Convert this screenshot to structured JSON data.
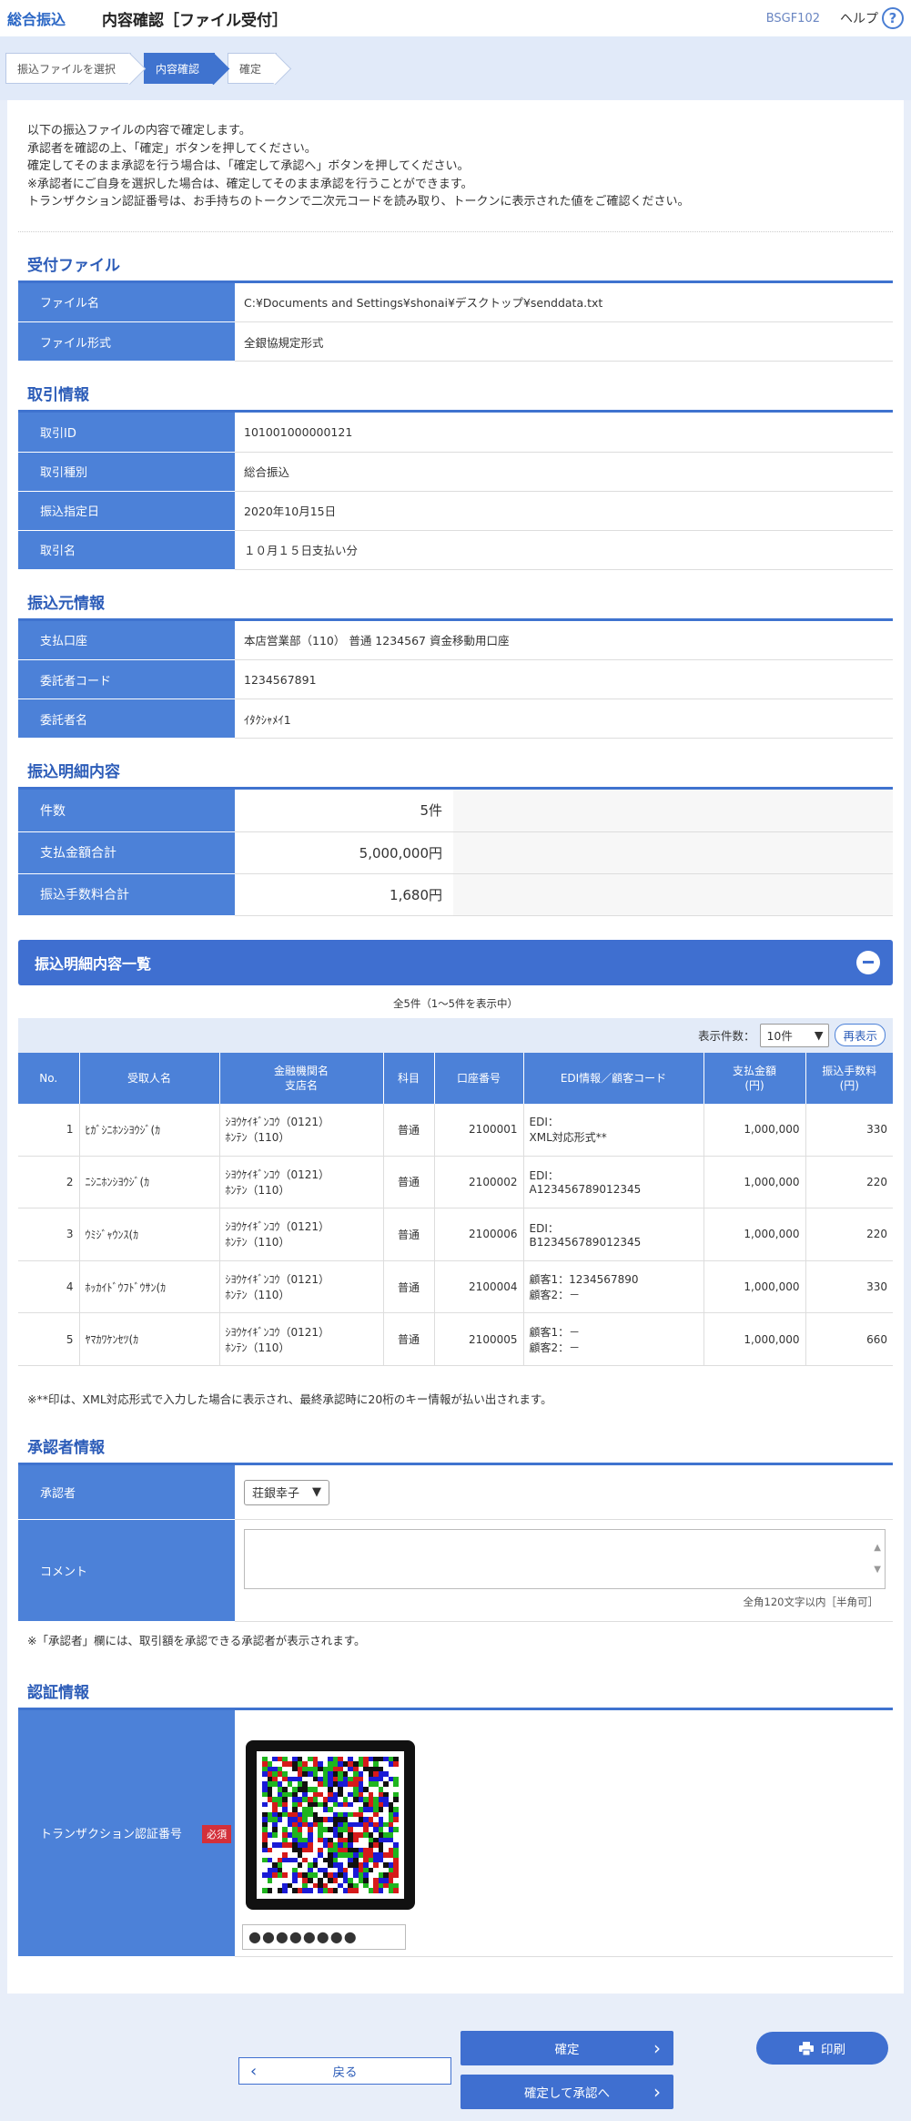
{
  "header": {
    "app_name": "総合振込",
    "title": "内容確認［ファイル受付］",
    "screen_code": "BSGF102",
    "help_label": "ヘルプ",
    "help_icon": "?"
  },
  "steps": [
    {
      "label": "振込ファイルを選択",
      "active": false
    },
    {
      "label": "内容確認",
      "active": true
    },
    {
      "label": "確定",
      "active": false
    }
  ],
  "intro": [
    "以下の振込ファイルの内容で確定します。",
    "承認者を確認の上、「確定」ボタンを押してください。",
    "確定してそのまま承認を行う場合は、「確定して承認へ」ボタンを押してください。",
    "※承認者にご自身を選択した場合は、確定してそのまま承認を行うことができます。",
    "トランザクション認証番号は、お手持ちのトークンで二次元コードを読み取り、トークンに表示された値をご確認ください。"
  ],
  "file_section": {
    "title": "受付ファイル",
    "rows": [
      {
        "label": "ファイル名",
        "value": "C:¥Documents and Settings¥shonai¥デスクトップ¥senddata.txt"
      },
      {
        "label": "ファイル形式",
        "value": "全銀協規定形式"
      }
    ]
  },
  "transaction_section": {
    "title": "取引情報",
    "rows": [
      {
        "label": "取引ID",
        "value": "101001000000121"
      },
      {
        "label": "取引種別",
        "value": "総合振込"
      },
      {
        "label": "振込指定日",
        "value": "2020年10月15日"
      },
      {
        "label": "取引名",
        "value": "１０月１５日支払い分"
      }
    ]
  },
  "source_section": {
    "title": "振込元情報",
    "rows": [
      {
        "label": "支払口座",
        "value": "本店営業部（110） 普通 1234567 資金移動用口座"
      },
      {
        "label": "委託者コード",
        "value": "1234567891"
      },
      {
        "label": "委託者名",
        "value": "ｲﾀｸｼｬﾒｲ1"
      }
    ]
  },
  "summary_section": {
    "title": "振込明細内容",
    "rows": [
      {
        "label": "件数",
        "value": "5件"
      },
      {
        "label": "支払金額合計",
        "value": "5,000,000円"
      },
      {
        "label": "振込手数料合計",
        "value": "1,680円"
      }
    ]
  },
  "detail_list": {
    "title": "振込明細内容一覧",
    "count_text": "全5件（1〜5件を表示中）",
    "per_page_label": "表示件数：",
    "per_page_value": "10件",
    "redisplay_label": "再表示",
    "headers": [
      "No.",
      "受取人名",
      "金融機関名\n支店名",
      "科目",
      "口座番号",
      "EDI情報／顧客コード",
      "支払金額\n(円)",
      "振込手数料\n(円)"
    ],
    "rows": [
      {
        "no": "1",
        "name": "ﾋｶﾞｼﾆﾎﾝｼﾖｳｼﾞ(ｶ",
        "bank": "ｼﾖｳｹｲｷﾞﾝｺｳ（0121）",
        "branch": "ﾎﾝﾃﾝ（110）",
        "type": "普通",
        "account": "2100001",
        "edi1": "EDI：",
        "edi2": "XML対応形式**",
        "amount": "1,000,000",
        "fee": "330"
      },
      {
        "no": "2",
        "name": "ﾆｼﾆﾎﾝｼﾖｳｼﾞ(ｶ",
        "bank": "ｼﾖｳｹｲｷﾞﾝｺｳ（0121）",
        "branch": "ﾎﾝﾃﾝ（110）",
        "type": "普通",
        "account": "2100002",
        "edi1": "EDI：",
        "edi2": "A123456789012345",
        "amount": "1,000,000",
        "fee": "220"
      },
      {
        "no": "3",
        "name": "ｳﾐｼﾞｬｳﾝｽ(ｶ",
        "bank": "ｼﾖｳｹｲｷﾞﾝｺｳ（0121）",
        "branch": "ﾎﾝﾃﾝ（110）",
        "type": "普通",
        "account": "2100006",
        "edi1": "EDI：",
        "edi2": "B123456789012345",
        "amount": "1,000,000",
        "fee": "220"
      },
      {
        "no": "4",
        "name": "ﾎｯｶｲﾄﾞｳﾌﾄﾞｳｻﾝ(ｶ",
        "bank": "ｼﾖｳｹｲｷﾞﾝｺｳ（0121）",
        "branch": "ﾎﾝﾃﾝ（110）",
        "type": "普通",
        "account": "2100004",
        "edi1": "顧客1：1234567890",
        "edi2": "顧客2：－",
        "amount": "1,000,000",
        "fee": "330"
      },
      {
        "no": "5",
        "name": "ﾔﾏｶﾜｹﾝｾﾂ(ｶ",
        "bank": "ｼﾖｳｹｲｷﾞﾝｺｳ（0121）",
        "branch": "ﾎﾝﾃﾝ（110）",
        "type": "普通",
        "account": "2100005",
        "edi1": "顧客1：－",
        "edi2": "顧客2：－",
        "amount": "1,000,000",
        "fee": "660"
      }
    ],
    "note": "※**印は、XML対応形式で入力した場合に表示され、最終承認時に20桁のキー情報が払い出されます。"
  },
  "approver_section": {
    "title": "承認者情報",
    "approver_label": "承認者",
    "approver_value": "荘銀幸子",
    "comment_label": "コメント",
    "comment_value": "",
    "comment_hint": "全角120文字以内［半角可］",
    "note": "※「承認者」欄には、取引額を承認できる承認者が表示されます。"
  },
  "auth_section": {
    "title": "認証情報",
    "label": "トランザクション認証番号",
    "required": "必須",
    "otp_value": "●●●●●●●●"
  },
  "buttons": {
    "confirm": "確定",
    "confirm_approve": "確定して承認へ",
    "back": "戻る",
    "print": "印刷"
  },
  "colors": {
    "accent": "#3f6fd0",
    "label_bg": "#4c81d8",
    "title": "#2c5cb8",
    "required": "#d3303a"
  }
}
